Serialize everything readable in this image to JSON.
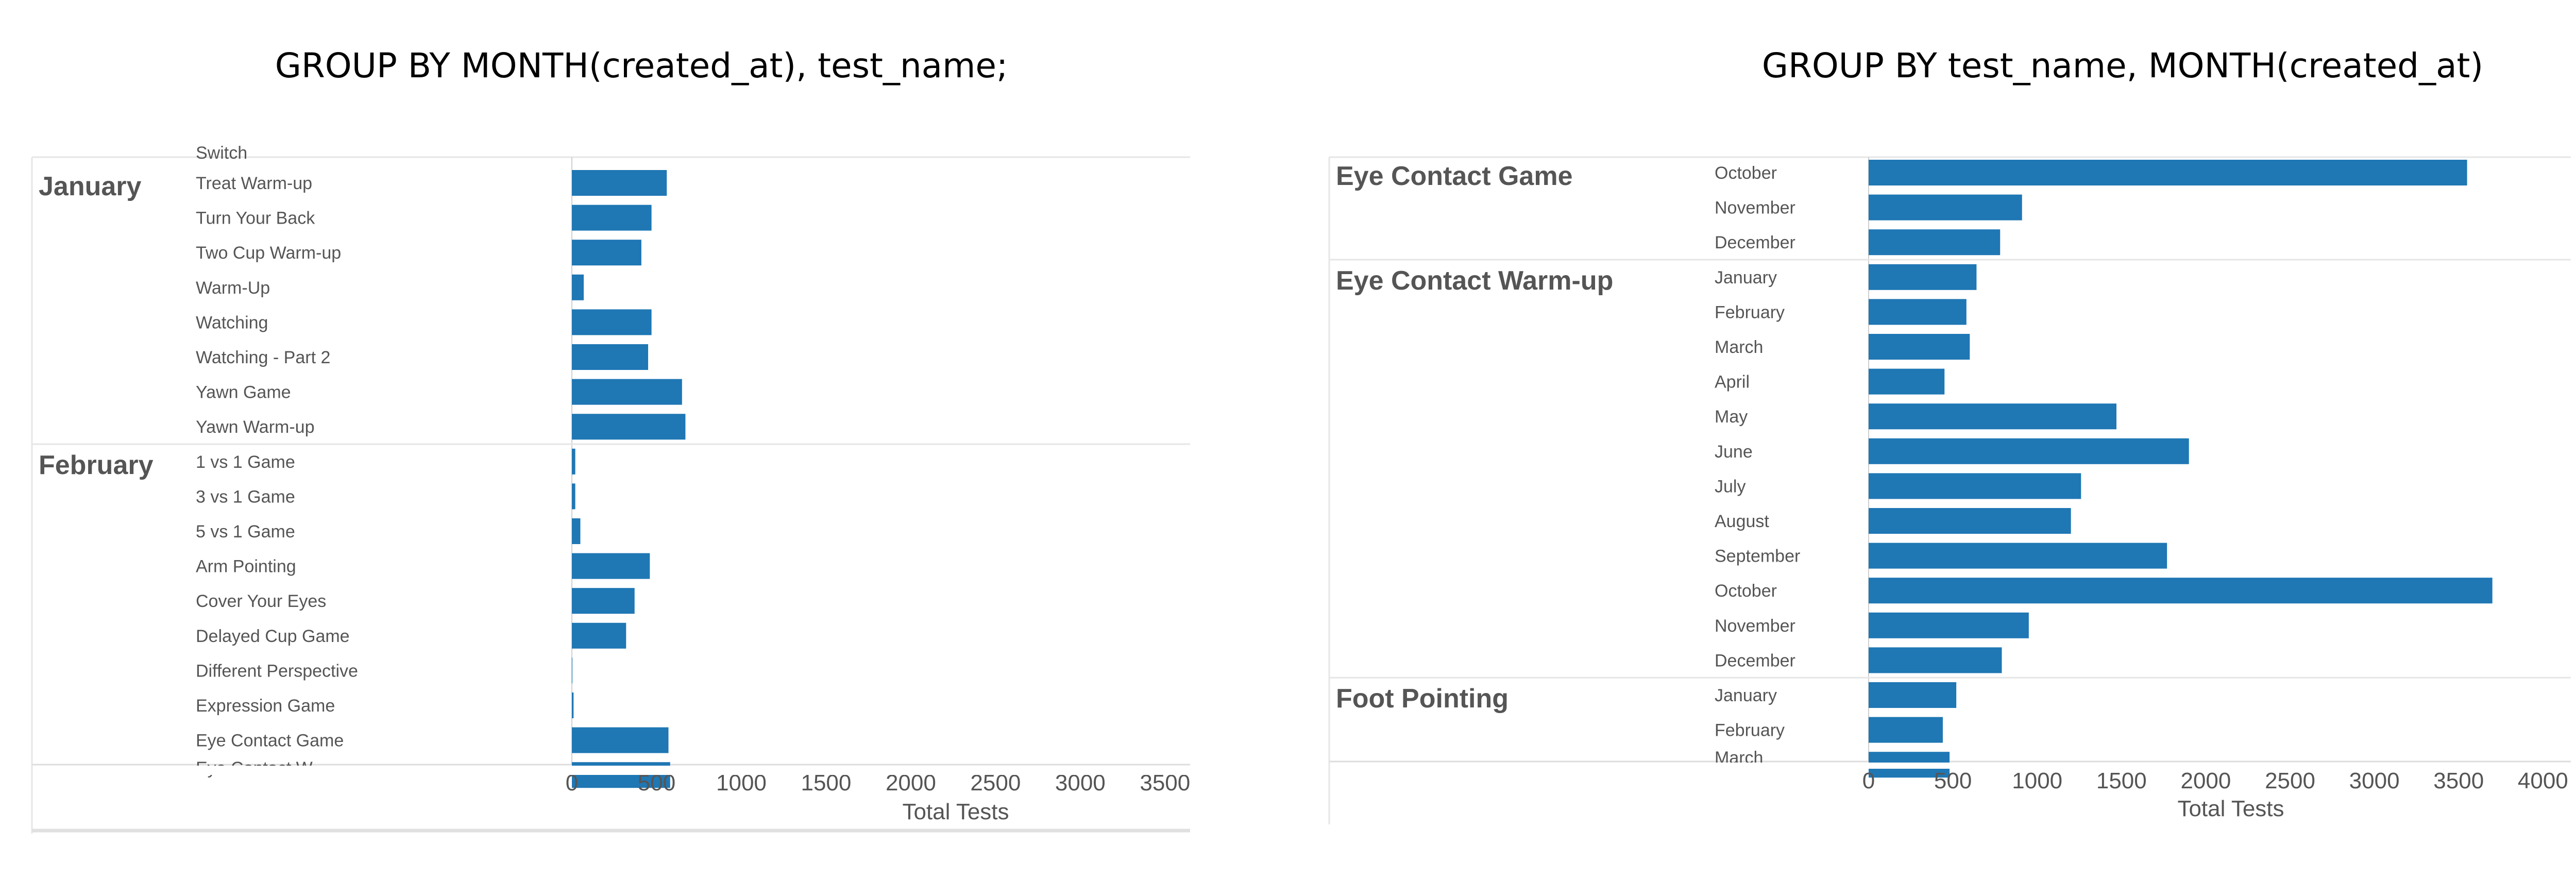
{
  "chart_data": [
    {
      "type": "bar",
      "orientation": "horizontal",
      "title": "GROUP BY MONTH(created_at), test_name;",
      "xlabel": "Total Tests",
      "xlim": [
        0,
        3800
      ],
      "x_ticks": [
        "0",
        "500",
        "1000",
        "1500",
        "2000",
        "2500",
        "3000",
        "3500"
      ],
      "grid": false,
      "clipped_top_label": "Switch",
      "groups": [
        {
          "name": "January",
          "rows": [
            {
              "label": "Treat Warm-up",
              "value": 560
            },
            {
              "label": "Turn Your Back",
              "value": 470
            },
            {
              "label": "Two Cup Warm-up",
              "value": 410
            },
            {
              "label": "Warm-Up",
              "value": 70
            },
            {
              "label": "Watching",
              "value": 470
            },
            {
              "label": "Watching - Part 2",
              "value": 450
            },
            {
              "label": "Yawn Game",
              "value": 650
            },
            {
              "label": "Yawn Warm-up",
              "value": 670
            }
          ]
        },
        {
          "name": "February",
          "rows": [
            {
              "label": "1 vs 1 Game",
              "value": 20
            },
            {
              "label": "3 vs 1 Game",
              "value": 20
            },
            {
              "label": "5 vs 1 Game",
              "value": 50
            },
            {
              "label": "Arm Pointing",
              "value": 460
            },
            {
              "label": "Cover Your Eyes",
              "value": 370
            },
            {
              "label": "Delayed Cup Game",
              "value": 320
            },
            {
              "label": "Different Perspective",
              "value": 0
            },
            {
              "label": "Expression Game",
              "value": 10
            },
            {
              "label": "Eye Contact Game",
              "value": 570
            }
          ]
        }
      ],
      "clipped_bottom_label": "Eye Contact W...",
      "clipped_bottom_value": 580
    },
    {
      "type": "bar",
      "orientation": "horizontal",
      "title": "GROUP BY test_name, MONTH(created_at)",
      "xlabel": "Total Tests",
      "xlim": [
        0,
        4300
      ],
      "x_ticks": [
        "0",
        "500",
        "1000",
        "1500",
        "2000",
        "2500",
        "3000",
        "3500",
        "4000"
      ],
      "grid": false,
      "groups": [
        {
          "name": "Eye Contact Game",
          "rows": [
            {
              "label": "October",
              "value": 3550
            },
            {
              "label": "November",
              "value": 910
            },
            {
              "label": "December",
              "value": 780
            }
          ]
        },
        {
          "name": "Eye Contact Warm-up",
          "rows": [
            {
              "label": "January",
              "value": 640
            },
            {
              "label": "February",
              "value": 580
            },
            {
              "label": "March",
              "value": 600
            },
            {
              "label": "April",
              "value": 450
            },
            {
              "label": "May",
              "value": 1470
            },
            {
              "label": "June",
              "value": 1900
            },
            {
              "label": "July",
              "value": 1260
            },
            {
              "label": "August",
              "value": 1200
            },
            {
              "label": "September",
              "value": 1770
            },
            {
              "label": "October",
              "value": 3700
            },
            {
              "label": "November",
              "value": 950
            },
            {
              "label": "December",
              "value": 790
            }
          ]
        },
        {
          "name": "Foot Pointing",
          "rows": [
            {
              "label": "January",
              "value": 520
            },
            {
              "label": "February",
              "value": 440
            }
          ]
        }
      ],
      "clipped_bottom_label": "March",
      "clipped_bottom_value": 480
    }
  ],
  "colors": {
    "bar": "#1f77b4",
    "divider": "#e6e6e6",
    "text": "#555555"
  }
}
